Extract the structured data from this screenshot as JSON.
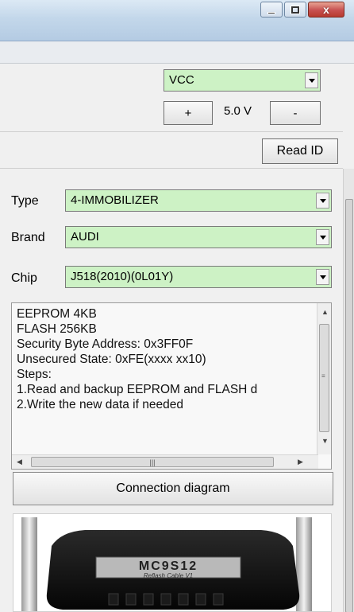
{
  "window": {
    "minimize_glyph": "minimize-icon",
    "maximize_glyph": "maximize-icon",
    "close_glyph": "x"
  },
  "power": {
    "select_value": "VCC",
    "plus_label": "+",
    "voltage": "5.0 V",
    "minus_label": "-"
  },
  "read_id_label": "Read ID",
  "selector": {
    "type_label": "Type",
    "type_value": "4-IMMOBILIZER",
    "brand_label": "Brand",
    "brand_value": "AUDI",
    "chip_label": "Chip",
    "chip_value": "J518(2010)(0L01Y)"
  },
  "info_lines": [
    "EEPROM 4KB",
    "FLASH 256KB",
    "Security Byte Address: 0x3FF0F",
    "Unsecured State: 0xFE(xxxx xx10)",
    "Steps:",
    "1.Read and backup EEPROM and FLASH d",
    "2.Write the new data if needed"
  ],
  "connection_diagram_label": "Connection diagram",
  "cable": {
    "model": "MC9S12",
    "subtitle": "Reflash Cable V1"
  },
  "colors": {
    "select_bg": "#cdf2c5",
    "title_gradient_top": "#dce9f5",
    "close_red": "#c75050"
  }
}
